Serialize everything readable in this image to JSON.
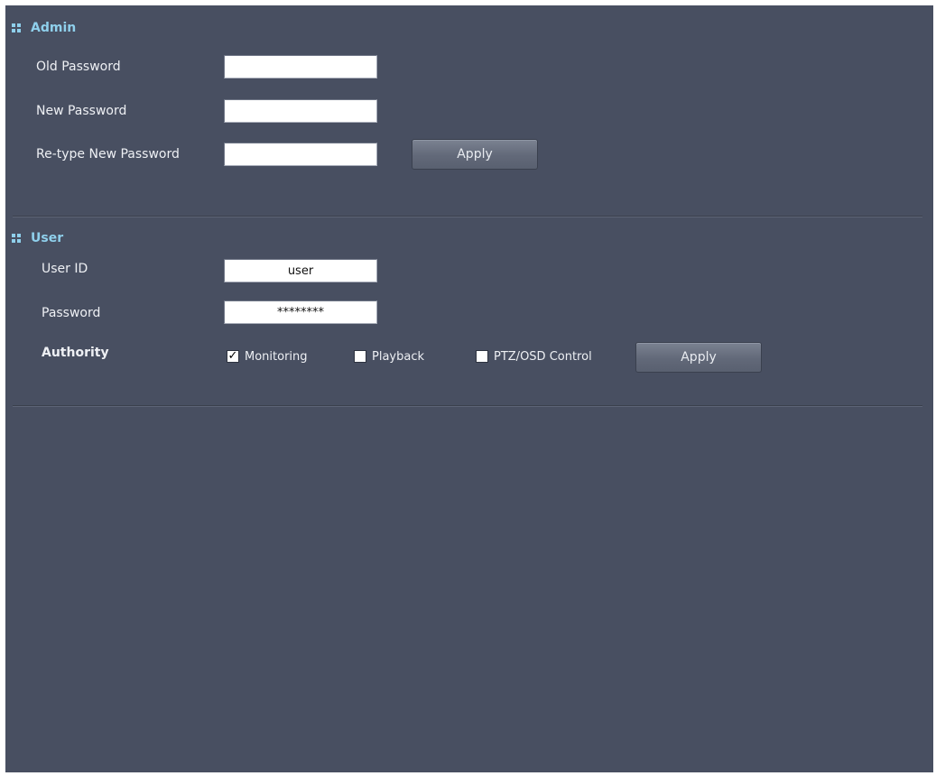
{
  "admin": {
    "title": "Admin",
    "old_password_label": "Old Password",
    "new_password_label": "New Password",
    "retype_label": "Re-type New Password",
    "old_password_value": "",
    "new_password_value": "",
    "retype_value": "",
    "apply_label": "Apply"
  },
  "user": {
    "title": "User",
    "user_id_label": "User ID",
    "user_id_value": "user",
    "password_label": "Password",
    "password_value": "********",
    "authority_label": "Authority",
    "permissions": [
      {
        "label": "Monitoring",
        "checked": true
      },
      {
        "label": "Playback",
        "checked": false
      },
      {
        "label": "PTZ/OSD Control",
        "checked": false
      }
    ],
    "apply_label": "Apply"
  },
  "colors": {
    "panel_bg": "#484f61",
    "section_title": "#8fd0ec",
    "text": "#eef0f4"
  },
  "icons": {
    "section": "grip-icon",
    "checked": "checkmark-icon"
  }
}
